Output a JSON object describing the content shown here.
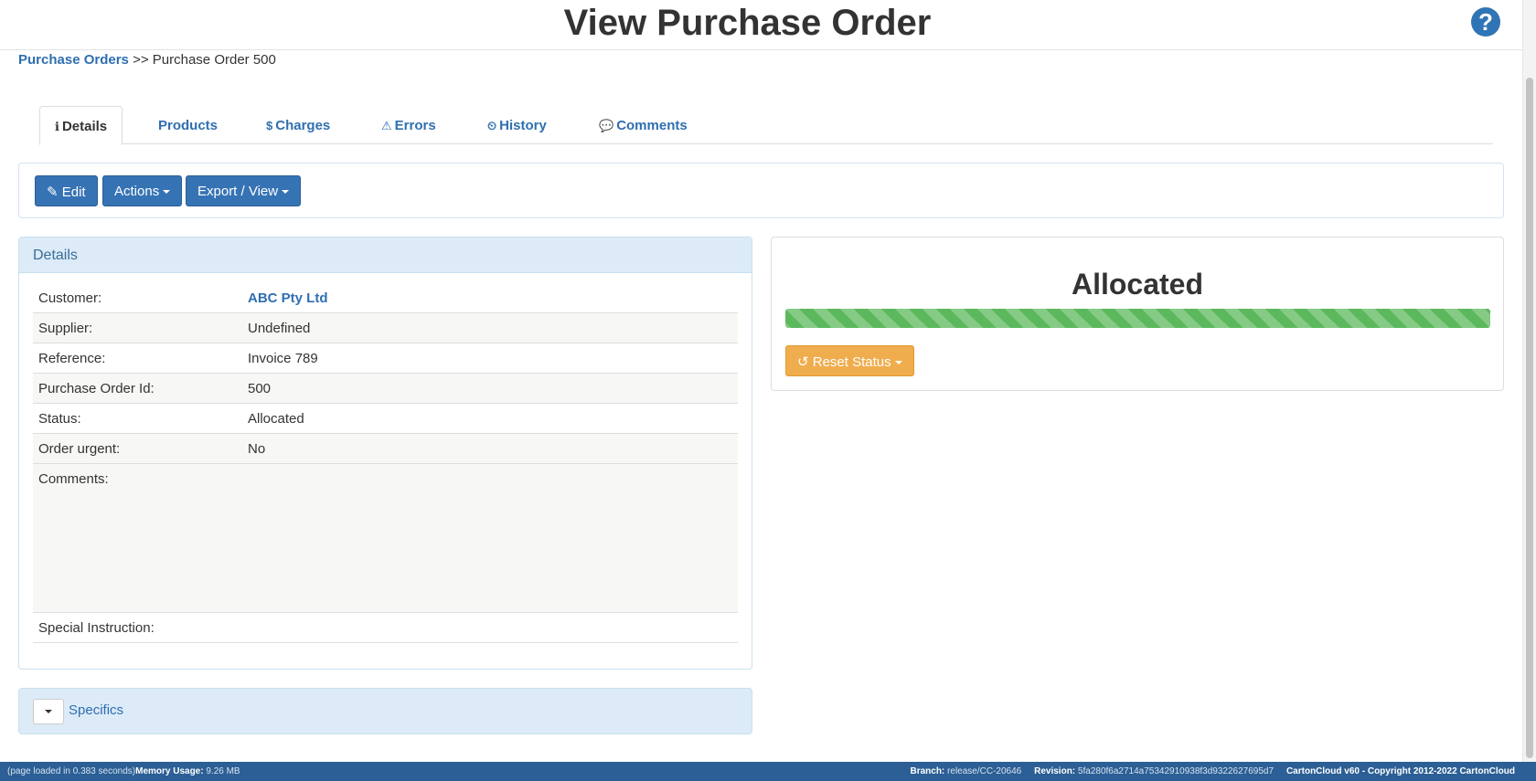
{
  "header": {
    "title": "View Purchase Order",
    "help_symbol": "?"
  },
  "breadcrumb": {
    "root": "Purchase Orders",
    "separator": ">>",
    "current": "Purchase Order 500"
  },
  "tabs": [
    {
      "icon": "info-icon",
      "glyph": "ℹ",
      "label": "Details",
      "active": true
    },
    {
      "label": "Products"
    },
    {
      "icon": "dollar-icon",
      "glyph": "$",
      "label": "Charges"
    },
    {
      "icon": "warning-icon",
      "glyph": "⚠",
      "label": "Errors"
    },
    {
      "icon": "clock-icon",
      "glyph": "⏲",
      "label": "History"
    },
    {
      "icon": "comment-icon",
      "glyph": "💬",
      "label": "Comments"
    }
  ],
  "toolbar": {
    "edit_label": "Edit",
    "edit_glyph": "✎",
    "actions_label": "Actions",
    "export_label": "Export / View"
  },
  "details": {
    "heading": "Details",
    "rows": [
      {
        "label": "Customer:",
        "value": "ABC Pty Ltd"
      },
      {
        "label": "Supplier:",
        "value": "Undefined"
      },
      {
        "label": "Reference:",
        "value": "Invoice 789"
      },
      {
        "label": "Purchase Order Id:",
        "value": "500"
      },
      {
        "label": "Status:",
        "value": "Allocated"
      },
      {
        "label": "Order urgent:",
        "value": "No"
      },
      {
        "label": "Comments:",
        "value": ""
      },
      {
        "label": "Special Instruction:",
        "value": ""
      }
    ]
  },
  "status": {
    "title": "Allocated",
    "progress": 1.0,
    "progress_color": "#5cb85c",
    "reset_label": "Reset Status",
    "reset_glyph": "↺"
  },
  "specifics": {
    "label": "Specifics"
  },
  "footer": {
    "load_text": "(page loaded in 0.383 seconds)",
    "memory_label": "Memory Usage:",
    "memory_value": "9.26 MB",
    "branch_label": "Branch:",
    "branch_value": "release/CC-20646",
    "revision_label": "Revision:",
    "revision_value": "5fa280f6a2714a75342910938f3d9322627695d7",
    "version_text": "CartonCloud v60 - Copyright 2012-2022",
    "brand": "CartonCloud"
  },
  "colors": {
    "primary": "#3673b4",
    "warning": "#f0ad4e",
    "success": "#5cb85c",
    "panel_heading": "#dcebf7",
    "footer": "#2c5f95"
  }
}
